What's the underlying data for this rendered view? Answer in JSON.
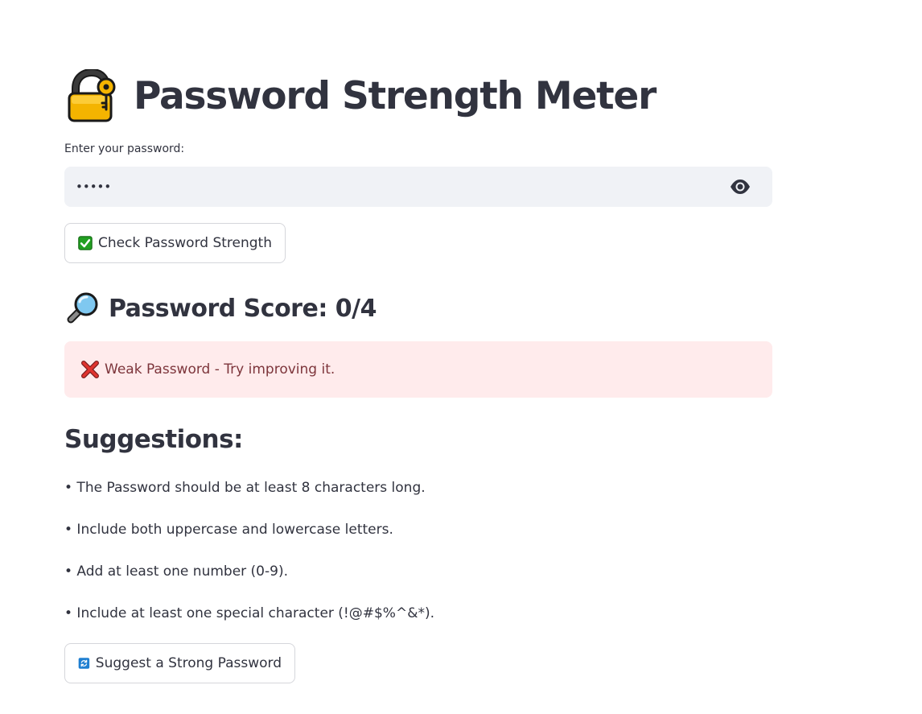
{
  "app": {
    "title": "Password Strength Meter",
    "title_icon": "lock-with-key-icon"
  },
  "password_field": {
    "label": "Enter your password:",
    "value": "•••••",
    "toggle_icon": "eye-icon"
  },
  "check_button": {
    "label": "Check Password Strength",
    "icon": "check-mark-icon"
  },
  "score": {
    "label": "Password Score: 0/4",
    "value": 0,
    "max": 4,
    "icon": "magnifier-icon"
  },
  "alert": {
    "text": "Weak Password - Try improving it.",
    "icon": "cross-mark-icon",
    "background": "#ffebec",
    "text_color": "#7d353b"
  },
  "suggestions": {
    "title": "Suggestions:",
    "items": [
      "• The Password should be at least 8 characters long.",
      "• Include both uppercase and lowercase letters.",
      "• Add at least one number (0-9).",
      "• Include at least one special character (!@#$%^&*)."
    ]
  },
  "suggest_button": {
    "label": "Suggest a Strong Password",
    "icon": "refresh-icon"
  },
  "colors": {
    "text": "#31333f",
    "input_bg": "#f0f2f6",
    "button_border": "#d5d6db"
  }
}
